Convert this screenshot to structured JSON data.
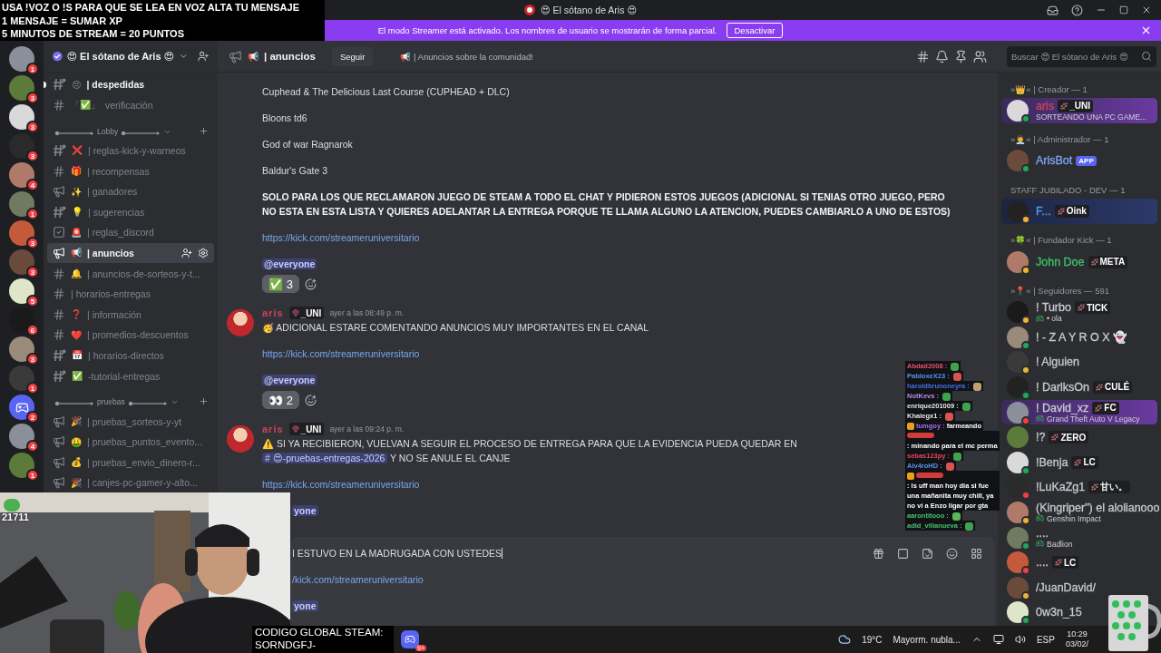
{
  "window": {
    "title": "😍 El sótano de Aris 😍"
  },
  "stream_overlay": {
    "lines": [
      "USA !VOZ O !S PARA QUE SE LEA EN VOZ ALTA TU MENSAJE",
      "1 MENSAJE = SUMAR XP",
      "5 MINUTOS DE STREAM = 20 PUNTOS"
    ]
  },
  "banner": {
    "text": "El modo Streamer está activado. Los nombres de usuario se mostrarán de forma parcial.",
    "button": "Desactivar"
  },
  "server": {
    "name": "😍 El sótano de Aris 😍"
  },
  "server_rail": [
    {
      "kind": "avatar",
      "badge": "1"
    },
    {
      "kind": "avatar",
      "badge": "3"
    },
    {
      "kind": "avatar",
      "badge": "3"
    },
    {
      "kind": "avatar",
      "badge": "3"
    },
    {
      "kind": "avatar",
      "badge": "4"
    },
    {
      "kind": "avatar",
      "badge": "1"
    },
    {
      "kind": "avatar",
      "badge": "3"
    },
    {
      "kind": "avatar",
      "badge": "3"
    },
    {
      "kind": "avatar",
      "badge": "5"
    },
    {
      "kind": "avatar",
      "badge": "6"
    },
    {
      "kind": "avatar",
      "badge": "3"
    },
    {
      "kind": "avatar",
      "badge": "1"
    },
    {
      "kind": "discord",
      "badge": "2"
    },
    {
      "kind": "avatar",
      "badge": "4"
    },
    {
      "kind": "avatar",
      "badge": "1"
    }
  ],
  "channels": [
    {
      "kind": "text-dot",
      "emoji": "😣",
      "name": "| despedidas",
      "unread": true,
      "selected": false
    },
    {
      "kind": "text",
      "emoji": "「✅」",
      "name": "verificación",
      "unread": false,
      "selected": false
    },
    {
      "kind": "category",
      "name": "Lobby"
    },
    {
      "kind": "text-dot",
      "emoji": "❌",
      "name": "| reglas-kick-y-warneos",
      "unread": false,
      "selected": false
    },
    {
      "kind": "text",
      "emoji": "🎁",
      "name": "| recompensas",
      "unread": false,
      "selected": false
    },
    {
      "kind": "announcement",
      "emoji": "✨",
      "name": "| ganadores",
      "unread": false,
      "selected": false
    },
    {
      "kind": "text-dot",
      "emoji": "💡",
      "name": "| sugerencias",
      "unread": false,
      "selected": false
    },
    {
      "kind": "rules",
      "emoji": "🚨",
      "name": "| reglas_discord",
      "unread": false,
      "selected": false
    },
    {
      "kind": "announcement",
      "emoji": "📢",
      "name": "| anuncios",
      "unread": false,
      "selected": true
    },
    {
      "kind": "text",
      "emoji": "🔔",
      "name": "| anuncios-de-sorteos-y-t...",
      "unread": false,
      "selected": false
    },
    {
      "kind": "text",
      "name": "| horarios-entregas",
      "unread": false,
      "selected": false
    },
    {
      "kind": "text",
      "emoji": "❓",
      "name": "| información",
      "unread": false,
      "selected": false
    },
    {
      "kind": "text",
      "emoji": "❤️",
      "name": "| promedios-descuentos",
      "unread": false,
      "selected": false
    },
    {
      "kind": "text-dot",
      "emoji": "📅",
      "name": "| horarios-directos",
      "unread": false,
      "selected": false
    },
    {
      "kind": "text-dot",
      "emoji": "✅",
      "name": "-tutorial-entregas",
      "unread": false,
      "selected": false
    },
    {
      "kind": "category",
      "name": "pruebas"
    },
    {
      "kind": "announcement",
      "emoji": "🎉",
      "name": "| pruebas_sorteos-y-yt",
      "unread": false,
      "selected": false
    },
    {
      "kind": "announcement",
      "emoji": "🤑",
      "name": "| pruebas_puntos_evento...",
      "unread": false,
      "selected": false
    },
    {
      "kind": "announcement",
      "emoji": "💰",
      "name": "| pruebas_envio_dinero-r...",
      "unread": false,
      "selected": false
    },
    {
      "kind": "announcement",
      "emoji": "🎉",
      "name": "| canjes-pc-gamer-y-alto...",
      "unread": false,
      "selected": false
    }
  ],
  "channel_header": {
    "emoji": "📢",
    "name": "| anuncios",
    "follow_button": "Seguir",
    "topic": "📢 | Anuncios sobre la comunidad!"
  },
  "search": {
    "placeholder": "Buscar 😍 El sótano de Aris 😍"
  },
  "messages": [
    {
      "lines": [
        {
          "kind": "text",
          "text": "Cuphead & The Delicious Last Course (CUPHEAD + DLC)"
        },
        {
          "kind": "text",
          "text": "Bloons td6"
        },
        {
          "kind": "text",
          "text": "God of war Ragnarok"
        },
        {
          "kind": "text",
          "text": "Baldur's Gate 3"
        },
        {
          "kind": "bold",
          "text": "SOLO PARA LOS QUE RECLAMARON JUEGO DE STEAM A TODO EL CHAT Y PIDIERON ESTOS JUEGOS (ADICIONAL SI TENIAS OTRO JUEGO, PERO NO ESTA EN ESTA LISTA Y QUIERES ADELANTAR LA ENTREGA PORQUE TE LLAMA ALGUNO LA ATENCION, PUEDES CAMBIARLO A UNO DE ESTOS)"
        },
        {
          "kind": "link",
          "text": "https://kick.com/streameruniversitario"
        },
        {
          "kind": "mention",
          "text": "@everyone"
        }
      ],
      "reactions": [
        {
          "emoji": "✅",
          "count": "3",
          "selected": false
        }
      ]
    },
    {
      "author": "aris",
      "tag": "_UNI",
      "time": "ayer a las 08:49 p. m.",
      "lines": [
        {
          "kind": "text",
          "text": "🥳 ADICIONAL ESTARE COMENTANDO ANUNCIOS MUY IMPORTANTES EN EL CANAL"
        },
        {
          "kind": "link",
          "text": "https://kick.com/streameruniversitario"
        },
        {
          "kind": "mention",
          "text": "@everyone"
        }
      ],
      "reactions": [
        {
          "emoji": "👀",
          "count": "2",
          "selected": false
        }
      ]
    },
    {
      "author": "aris",
      "tag": "_UNI",
      "time": "ayer a las 09:24 p. m.",
      "lines": [
        {
          "kind": "text",
          "text": "⚠️ SI YA RECIBIERON, VUELVAN A SEGUIR EL PROCESO DE ENTREGA PARA QUE LA EVIDENCIA PUEDA QUEDAR EN",
          "channel": "# 😍-pruebas-entregas-2026",
          "after": "Y NO SE ANULE EL CANJE"
        },
        {
          "kind": "link",
          "text": "https://kick.com/streameruniversitario"
        },
        {
          "kind": "mention",
          "text": "yone",
          "partial": true
        }
      ]
    }
  ],
  "composer": {
    "lines": [
      {
        "kind": "text",
        "text": "I ESTUVO EN LA MADRUGADA CON USTEDES"
      },
      {
        "kind": "link",
        "text": "/kick.com/streameruniversitario"
      },
      {
        "kind": "mention",
        "text": "yone"
      }
    ]
  },
  "member_groups": [
    {
      "prefix": "»👑« |",
      "label": "Creador — 1",
      "members": [
        {
          "name": "aris",
          "color": "#d0435a",
          "tag": {
            "kind": "guild",
            "text": "_UNI"
          },
          "activity": {
            "kind": "custom",
            "text": "SORTEANDO UNA PC GAME..."
          },
          "status": {
            "kind": "online"
          },
          "nameplate": {
            "kind": "purple"
          }
        }
      ]
    },
    {
      "prefix": "»👨‍💼« |",
      "label": "Administrador — 1",
      "members": [
        {
          "name": "ArisBot",
          "color": "#7fa6f5",
          "tag": {
            "kind": "app",
            "text": "APP"
          },
          "status": {
            "kind": "online"
          }
        }
      ]
    },
    {
      "label": "STAFF JUBILADO - DEV — 1",
      "members": [
        {
          "name": "F...",
          "color": "#4f9ee8",
          "tag": {
            "kind": "guild",
            "text": "Oink"
          },
          "status": {
            "kind": "idle"
          },
          "nameplate": {
            "kind": "night"
          }
        }
      ]
    },
    {
      "prefix": "»🍀« |",
      "label": "Fundador Kick — 1",
      "members": [
        {
          "name": "John Doe",
          "color": "#3fc46a",
          "tag": {
            "kind": "guild",
            "text": "META"
          },
          "status": {
            "kind": "idle"
          }
        }
      ]
    },
    {
      "prefix": "»📍« |",
      "label": "Seguidores — 591",
      "members": [
        {
          "name": "! Turbo",
          "color": "#c9cbd1",
          "tag": {
            "kind": "guild",
            "text": "TICK"
          },
          "activity": {
            "kind": "game",
            "text": "• ola"
          },
          "status": {
            "kind": "idle"
          }
        },
        {
          "name": "! - Z A Y R O X 👻",
          "color": "#c9cbd1",
          "status": {
            "kind": "online"
          }
        },
        {
          "name": "! Alguien",
          "color": "#c9cbd1",
          "status": {
            "kind": "idle"
          }
        },
        {
          "name": "! DarlksOn",
          "color": "#c9cbd1",
          "tag": {
            "kind": "guild",
            "text": "CULÉ"
          },
          "status": {
            "kind": "online"
          }
        },
        {
          "name": "! David_xz",
          "color": "#c9cbd1",
          "tag": {
            "kind": "guild",
            "text": "FC"
          },
          "activity": {
            "kind": "game",
            "text": "Grand Theft Auto V Legacy"
          },
          "status": {
            "kind": "dnd"
          },
          "nameplate": {
            "kind": "purple"
          }
        },
        {
          "name": "!?",
          "color": "#c9cbd1",
          "tag": {
            "kind": "guild",
            "text": "ZERO"
          }
        },
        {
          "name": "!Benja",
          "color": "#c9cbd1",
          "tag": {
            "kind": "guild",
            "text": "LC"
          },
          "status": {
            "kind": "online"
          }
        },
        {
          "name": "!LuKaZg1",
          "color": "#c9cbd1",
          "tag": {
            "kind": "guild",
            "text": "甘い。"
          },
          "status": {
            "kind": "dnd"
          }
        },
        {
          "name": "(Kingriper\") el alolianooo",
          "color": "#c9cbd1",
          "activity": {
            "kind": "game",
            "text": "Genshin Impact"
          },
          "status": {
            "kind": "idle"
          }
        },
        {
          "name": "....",
          "color": "#c9cbd1",
          "activity": {
            "kind": "game",
            "text": "Badlion"
          },
          "status": {
            "kind": "online"
          }
        },
        {
          "name": "....",
          "color": "#c9cbd1",
          "tag": {
            "kind": "guild",
            "text": "LC"
          },
          "status": {
            "kind": "dnd"
          }
        },
        {
          "name": "/JuanDavid/",
          "color": "#c9cbd1",
          "status": {
            "kind": "idle"
          }
        },
        {
          "name": "0w3n_15",
          "color": "#c9cbd1",
          "status": {
            "kind": "online"
          }
        }
      ]
    }
  ],
  "chat_overlay": [
    {
      "name": "Abdail2008 :",
      "color": "#e8506e",
      "emote": true
    },
    {
      "name": "PabloxeX23 :",
      "color": "#5a92ee",
      "emote": true
    },
    {
      "name": "haroldbrunoneyra :",
      "color": "#4272e6",
      "emote": true
    },
    {
      "name": "NotKevs :",
      "color": "#b988f0",
      "emote": true
    },
    {
      "name": "enrique201009 :",
      "color": "#e6e6e6",
      "emote": true
    },
    {
      "name": "Khalegx1 :",
      "color": "#e6e6e6",
      "emote": true
    },
    {
      "name": "tumgoy :",
      "color": "#a56cf2",
      "text": "farmeando",
      "badge": true
    },
    {
      "color": "#d43b3b",
      "text": ": minando para el mc perma"
    },
    {
      "name": "sebas123py :",
      "color": "#e8445c",
      "emote": true
    },
    {
      "name": "Alv4roHD :",
      "color": "#5a92ee",
      "emote": true
    },
    {
      "color": "#d43b3b",
      "text": ": ls uff man hoy dia si fue una mañanita muy chill, ya no vi a Enzo ligar por gta",
      "badge": true
    },
    {
      "name": "aarontitooo :",
      "color": "#46c46e",
      "emote": true
    },
    {
      "name": "adid_villanueva :",
      "color": "#46c46e",
      "emote": true
    }
  ],
  "webcam": {
    "viewer_count": "21711"
  },
  "code_overlay": {
    "lines": [
      "CODIGO GLOBAL STEAM:",
      "SORNDGFJ-"
    ]
  },
  "taskbar": {
    "app_badge": "9+",
    "weather": "19°C",
    "forecast": "Mayorm. nubla...",
    "language": "ESP",
    "time": "10:29",
    "date": "03/02/"
  }
}
